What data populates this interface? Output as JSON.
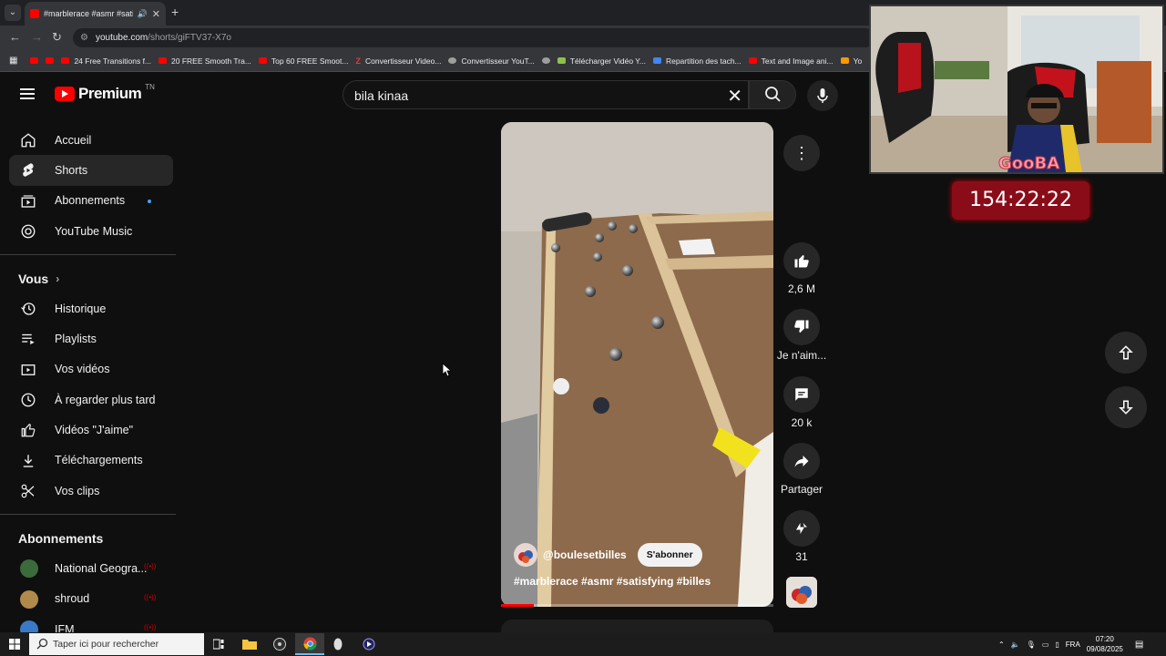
{
  "browser": {
    "tab_title": "#marblerace #asmr #satisfy",
    "url_host": "youtube.com",
    "url_path": "/shorts/giFTV37-X7o",
    "bookmarks": [
      {
        "label": "",
        "icon": "youtube-icon"
      },
      {
        "label": "",
        "icon": "youtube-icon"
      },
      {
        "label": "24 Free Transitions f...",
        "icon": "youtube-icon"
      },
      {
        "label": "20 FREE Smooth Tra...",
        "icon": "youtube-icon"
      },
      {
        "label": "Top 60 FREE Smoot...",
        "icon": "youtube-icon"
      },
      {
        "label": "Convertisseur Video...",
        "icon": "z-icon"
      },
      {
        "label": "Convertisseur YouT...",
        "icon": "globe-icon"
      },
      {
        "label": "",
        "icon": "globe-icon"
      },
      {
        "label": "Télécharger Vidéo Y...",
        "icon": "download-icon"
      },
      {
        "label": "Repartition des tach...",
        "icon": "doc-icon"
      },
      {
        "label": "Text and Image ani...",
        "icon": "youtube-icon"
      },
      {
        "label": "Yo",
        "icon": "orange-icon"
      }
    ]
  },
  "youtube": {
    "brand": "Premium",
    "region": "TN",
    "search_query": "bila kinaa",
    "sidebar_main": [
      {
        "label": "Accueil",
        "icon": "home-icon"
      },
      {
        "label": "Shorts",
        "icon": "shorts-icon",
        "active": true
      },
      {
        "label": "Abonnements",
        "icon": "subscriptions-icon",
        "dot": true
      },
      {
        "label": "YouTube Music",
        "icon": "music-icon"
      }
    ],
    "you_heading": "Vous",
    "sidebar_you": [
      {
        "label": "Historique",
        "icon": "history-icon"
      },
      {
        "label": "Playlists",
        "icon": "playlists-icon"
      },
      {
        "label": "Vos vidéos",
        "icon": "your-videos-icon"
      },
      {
        "label": "À regarder plus tard",
        "icon": "watch-later-icon"
      },
      {
        "label": "Vidéos \"J'aime\"",
        "icon": "like-icon"
      },
      {
        "label": "Téléchargements",
        "icon": "download-icon"
      },
      {
        "label": "Vos clips",
        "icon": "clips-icon"
      }
    ],
    "subs_heading": "Abonnements",
    "subscriptions": [
      {
        "label": "National Geogra...",
        "color": "#3b6b3a"
      },
      {
        "label": "shroud",
        "color": "#b08a4a"
      },
      {
        "label": "IFM",
        "color": "#3a79c6"
      }
    ],
    "short": {
      "channel": "@boulesetbilles",
      "subscribe": "S'abonner",
      "hashtags": "#marblerace #asmr #satisfying #billes",
      "likes": "2,6 M",
      "dislike": "Je n'aim...",
      "comments": "20 k",
      "share": "Partager",
      "remix": "31",
      "progress": 0.12
    }
  },
  "overlay": {
    "watermark": "GooBA",
    "timer": "154:22:22"
  },
  "taskbar": {
    "search_placeholder": "Taper ici pour rechercher",
    "lang": "FRA",
    "time": "07:20",
    "date": "09/08/2025"
  }
}
